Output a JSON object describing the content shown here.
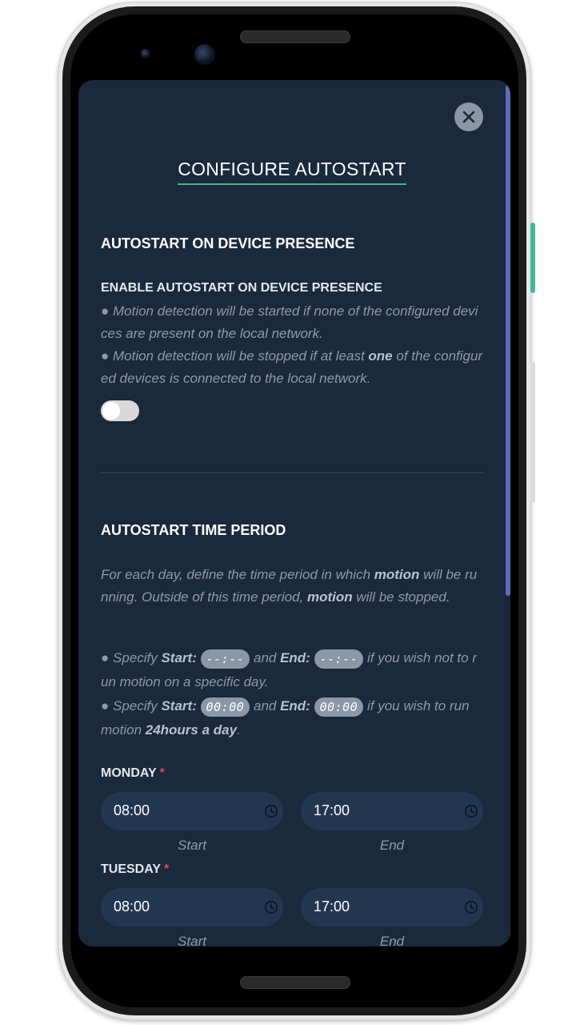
{
  "modal": {
    "title": "CONFIGURE AUTOSTART",
    "close_icon": "close-icon"
  },
  "presence": {
    "heading": "AUTOSTART ON DEVICE PRESENCE",
    "subheading": "ENABLE AUTOSTART ON DEVICE PRESENCE",
    "bullet1": "● Motion detection will be started if none of the configured devices are present on the local network.",
    "bullet2_pre": "● Motion detection will be stopped if at least ",
    "bullet2_bold": "one",
    "bullet2_post": " of the configured devices is connected to the local network.",
    "toggle_on": false
  },
  "period": {
    "heading": "AUTOSTART TIME PERIOD",
    "intro_1": "For each day, define the time period in which ",
    "intro_b1": "motion",
    "intro_2": " will be running. Outside of this time period, ",
    "intro_b2": "motion",
    "intro_3": " will be stopped.",
    "specify": "● Specify ",
    "start_label": "Start:",
    "and": " and ",
    "end_label": "End:",
    "empty_time": "--:--",
    "not_run_text": " if you wish not to run motion on a specific day.",
    "full_time": "00:00",
    "full_run_text_1": " if you wish to run motion ",
    "full_run_bold": "24hours a day",
    "full_run_text_2": "."
  },
  "days": [
    {
      "name": "MONDAY",
      "required": "*",
      "start": "08:00",
      "end": "17:00",
      "start_caption": "Start",
      "end_caption": "End"
    },
    {
      "name": "TUESDAY",
      "required": "*",
      "start": "08:00",
      "end": "17:00",
      "start_caption": "Start",
      "end_caption": "End"
    }
  ],
  "colors": {
    "background": "#1a293c",
    "accent": "#3fb889",
    "input": "#223650",
    "required": "#e0465d",
    "scrollbar": "#5b6fb8"
  }
}
